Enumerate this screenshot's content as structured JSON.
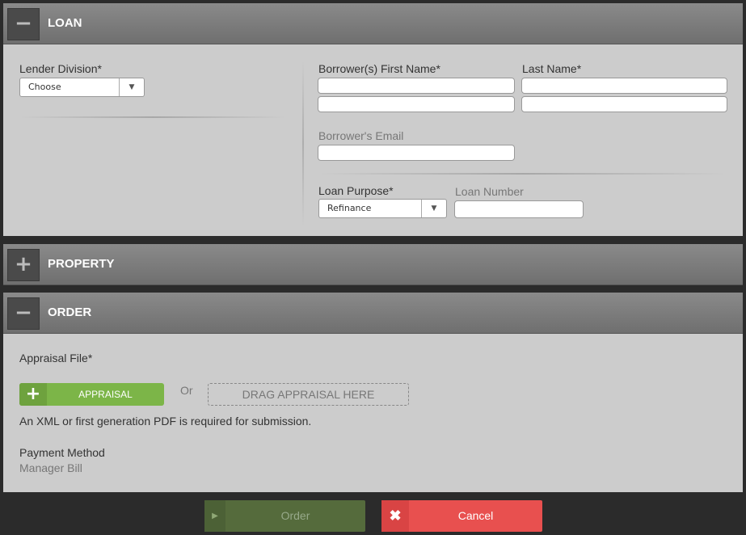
{
  "loan": {
    "toggle": "−",
    "title": "LOAN",
    "lender_division_label": "Lender Division*",
    "lender_division_value": "Choose",
    "first_name_label": "Borrower(s) First Name*",
    "last_name_label": "Last Name*",
    "email_label": "Borrower's Email",
    "loan_purpose_label": "Loan Purpose*",
    "loan_purpose_value": "Refinance",
    "loan_number_label": "Loan Number"
  },
  "property": {
    "toggle": "+",
    "title": "PROPERTY"
  },
  "order": {
    "toggle": "−",
    "title": "ORDER",
    "appraisal_file_label": "Appraisal File*",
    "appraisal_button": "APPRAISAL",
    "or_text": "Or",
    "drop_zone": "DRAG APPRAISAL HERE",
    "requirement_note": "An XML or first generation PDF is required for submission.",
    "payment_method_label": "Payment Method",
    "payment_method_value": "Manager Bill"
  },
  "footer": {
    "order_button": "Order",
    "cancel_button": "Cancel"
  },
  "colors": {
    "green": "#7cb548",
    "red": "#e8504f",
    "dark_green": "#556b3c"
  }
}
